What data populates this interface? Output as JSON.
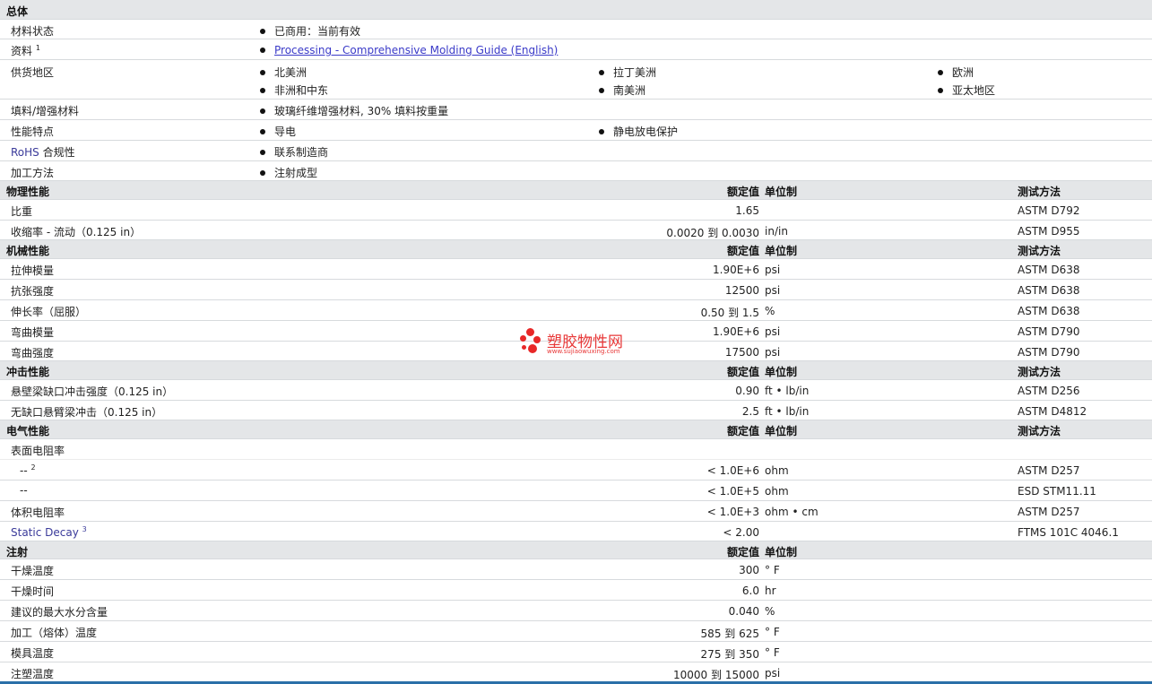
{
  "general": {
    "title": "总体",
    "rows": [
      {
        "label": "材料状态",
        "items": [
          "已商用：当前有效"
        ]
      },
      {
        "label": "资料",
        "sup": "1",
        "link": "Processing - Comprehensive Molding Guide (English)"
      },
      {
        "label": "供货地区",
        "items": [
          "北美洲",
          "拉丁美洲",
          "欧洲",
          "非洲和中东",
          "南美洲",
          "亚太地区"
        ]
      },
      {
        "label": "填料/增强材料",
        "items": [
          "玻璃纤维增强材料, 30% 填料按重量"
        ]
      },
      {
        "label": "性能特点",
        "items": [
          "导电",
          "静电放电保护"
        ]
      },
      {
        "label_prefix": "RoHS",
        "label": " 合规性",
        "items": [
          "联系制造商"
        ]
      },
      {
        "label": "加工方法",
        "items": [
          "注射成型"
        ]
      }
    ]
  },
  "headers": {
    "value": "额定值",
    "unit": "单位制",
    "test": "测试方法"
  },
  "physical": {
    "title": "物理性能",
    "rows": [
      {
        "label": "比重",
        "value": "1.65",
        "unit": "",
        "test": "ASTM D792"
      },
      {
        "label": "收缩率  - 流动（0.125 in）",
        "value": "0.0020 到  0.0030",
        "unit": "in/in",
        "test": "ASTM D955"
      }
    ]
  },
  "mechanical": {
    "title": "机械性能",
    "rows": [
      {
        "label": "拉伸模量",
        "value": "1.90E+6",
        "unit": "psi",
        "test": "ASTM D638"
      },
      {
        "label": "抗张强度",
        "value": "12500",
        "unit": "psi",
        "test": "ASTM D638"
      },
      {
        "label": "伸长率（屈服）",
        "value": "0.50 到  1.5",
        "unit": "%",
        "test": "ASTM D638"
      },
      {
        "label": "弯曲模量",
        "value": "1.90E+6",
        "unit": "psi",
        "test": "ASTM D790"
      },
      {
        "label": "弯曲强度",
        "value": "17500",
        "unit": "psi",
        "test": "ASTM D790"
      }
    ]
  },
  "impact": {
    "title": "冲击性能",
    "rows": [
      {
        "label": "悬壁梁缺口冲击强度（0.125 in）",
        "value": "0.90",
        "unit": "ft • lb/in",
        "test": "ASTM D256"
      },
      {
        "label": "无缺口悬臂梁冲击（0.125 in）",
        "value": "2.5",
        "unit": "ft • lb/in",
        "test": "ASTM D4812"
      }
    ]
  },
  "electrical": {
    "title": "电气性能",
    "rows": [
      {
        "label": "表面电阻率",
        "value": "",
        "unit": "",
        "test": ""
      },
      {
        "label": "  --",
        "sup": "2",
        "value": "< 1.0E+6",
        "unit": "ohm",
        "test": "ASTM D257"
      },
      {
        "label": "  --",
        "value": "< 1.0E+5",
        "unit": "ohm",
        "test": "ESD STM11.11"
      },
      {
        "label": "体积电阻率",
        "value": "< 1.0E+3",
        "unit": "ohm • cm",
        "test": "ASTM D257"
      },
      {
        "label": "Static Decay",
        "sup": "3",
        "value": "< 2.00",
        "unit": "",
        "test": "FTMS 101C 4046.1"
      }
    ]
  },
  "injection": {
    "title": "注射",
    "rows": [
      {
        "label": "干燥温度",
        "value": "300",
        "unit": "° F"
      },
      {
        "label": "干燥时间",
        "value": "6.0",
        "unit": "hr"
      },
      {
        "label": "建议的最大水分含量",
        "value": "0.040",
        "unit": "%"
      },
      {
        "label": "加工（熔体）温度",
        "value": "585 到  625",
        "unit": "° F"
      },
      {
        "label": "模具温度",
        "value": "275 到  350",
        "unit": "° F"
      },
      {
        "label": "注塑温度",
        "value": "10000 到  15000",
        "unit": "psi"
      }
    ]
  },
  "watermark": {
    "text": "塑胶物性网",
    "url": "www.sujiaowuxing.com",
    "color": "#e83838"
  },
  "colors": {
    "section_bg": "#e4e6e8",
    "link": "#3a3ac8",
    "bottom_bar": "#2a6fa8"
  }
}
